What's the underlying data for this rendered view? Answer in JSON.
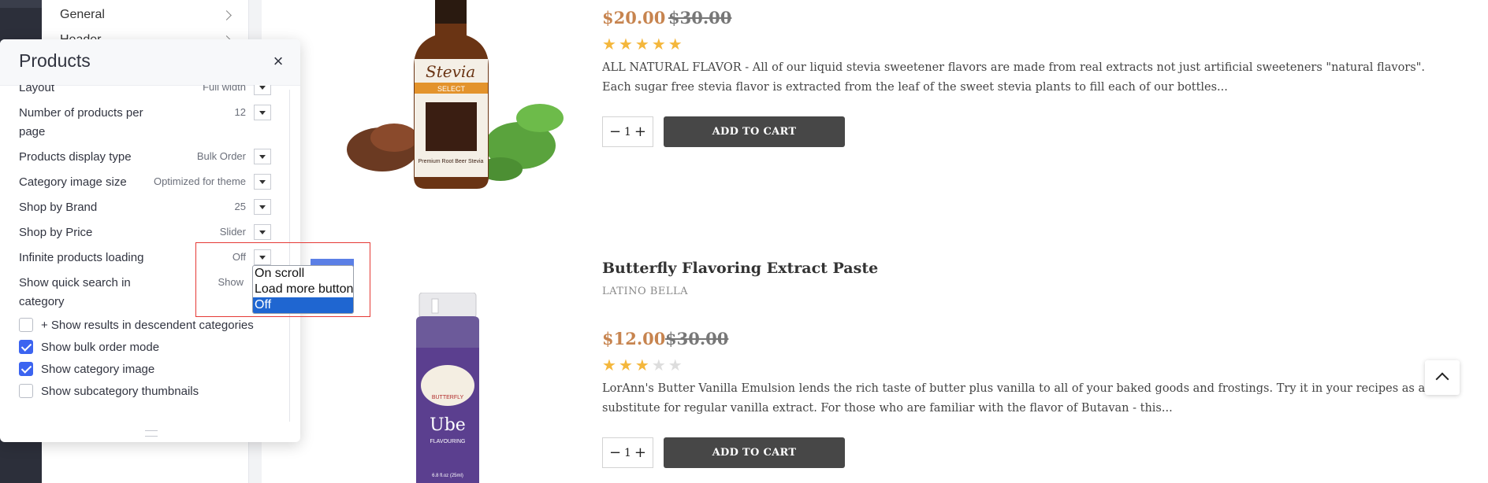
{
  "sidebar": {
    "items": [
      {
        "label": "General"
      },
      {
        "label": "Header"
      }
    ]
  },
  "panel": {
    "title": "Products",
    "close_symbol": "×",
    "partial_top_label": "Layout",
    "partial_top_value": "Full width",
    "settings": [
      {
        "label": "Number of products per page",
        "value": "12"
      },
      {
        "label": "Products display type",
        "value": "Bulk Order"
      },
      {
        "label": "Category image size",
        "value": "Optimized for theme"
      },
      {
        "label": "Shop by Brand",
        "value": "25"
      },
      {
        "label": "Shop by Price",
        "value": "Slider"
      },
      {
        "label": "Infinite products loading",
        "value": "Off"
      },
      {
        "label": "Show quick search in category",
        "value": "Show"
      }
    ],
    "checkboxes": [
      {
        "label": "+ Show results in descendent categories",
        "checked": false
      },
      {
        "label": "Show bulk order mode",
        "checked": true
      },
      {
        "label": "Show category image",
        "checked": true
      },
      {
        "label": "Show subcategory thumbnails",
        "checked": false
      }
    ]
  },
  "dropdown": {
    "options": [
      "On scroll",
      "Load more button",
      "Off"
    ],
    "selected": "Off"
  },
  "products": [
    {
      "price_new": "$20.00",
      "price_old": "$30.00",
      "rating": 5,
      "description": "ALL NATURAL FLAVOR - All of our liquid stevia sweetener flavors are made from real extracts not just artificial sweeteners \"natural flavors\". Each sugar free stevia flavor is extracted from the leaf of the sweet stevia plants to fill each of our bottles...",
      "qty": "1",
      "add_label": "ADD TO CART",
      "image_text": {
        "brand": "Stevia",
        "select": "SELECT",
        "name": "Premium Root Beer Stevia"
      }
    },
    {
      "title": "Butterfly Flavoring Extract Paste",
      "brand": "LATINO BELLA",
      "price_new": "$12.00",
      "price_old": "$30.00",
      "rating": 3,
      "description": "LorAnn's Butter Vanilla Emulsion lends the rich taste of butter plus vanilla to all of your baked goods and frostings. Try it in your recipes as a substitute for regular vanilla extract. For those who are familiar with the flavor of Butavan - this...",
      "qty": "1",
      "add_label": "ADD TO CART",
      "image_text": {
        "logo": "BUTTERFLY",
        "name": "Ube",
        "sub": "FLAVOURING",
        "size": "6.8 fl.oz (25ml)"
      }
    }
  ],
  "colors": {
    "accent_blue": "#3c64f0",
    "price": "#c7844f",
    "button_dark": "#474747",
    "star": "#f4b73c"
  }
}
